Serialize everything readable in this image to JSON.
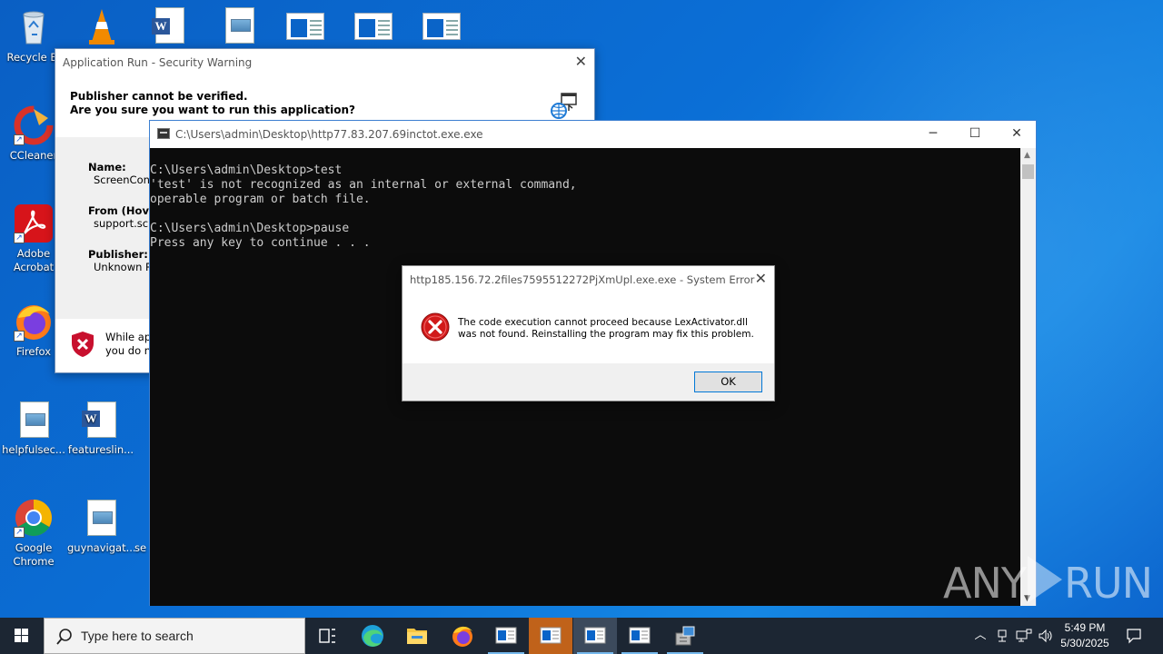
{
  "desktop_icons": [
    {
      "label": "Recycle Bi",
      "icon": "recycle-bin-icon"
    },
    {
      "label": "CCleaner",
      "icon": "ccleaner-icon"
    },
    {
      "label_line1": "Adobe",
      "label_line2": "Acrobat",
      "icon": "adobe-acrobat-icon"
    },
    {
      "label": "Firefox",
      "icon": "firefox-icon"
    },
    {
      "label": "helpfulsec...",
      "icon": "image-file-icon"
    },
    {
      "label": "featureslin...",
      "icon": "word-document-icon"
    },
    {
      "label_line1": "Google",
      "label_line2": "Chrome",
      "icon": "chrome-icon"
    },
    {
      "label": "guynavigat...",
      "icon": "image-file-icon"
    },
    {
      "label": "se",
      "icon": "file-icon"
    }
  ],
  "security_dialog": {
    "title": "Application Run - Security Warning",
    "heading_line1": "Publisher cannot be verified.",
    "heading_line2": "Are you sure you want to run this application?",
    "name_label": "Name:",
    "name_value": "ScreenConn",
    "from_label": "From (Hove",
    "from_value": "support.scre",
    "publisher_label": "Publisher:",
    "publisher_value": "Unknown P",
    "warning_line1": "While ap",
    "warning_line2": "you do n"
  },
  "console": {
    "title": "C:\\Users\\admin\\Desktop\\http77.83.207.69inctot.exe.exe",
    "lines": [
      "C:\\Users\\admin\\Desktop>test",
      "'test' is not recognized as an internal or external command,",
      "operable program or batch file.",
      "",
      "C:\\Users\\admin\\Desktop>pause",
      "Press any key to continue . . ."
    ]
  },
  "error_dialog": {
    "title": "http185.156.72.2files7595512272PjXmUpl.exe.exe - System Error",
    "message_line1": "The code execution cannot proceed because LexActivator.dll",
    "message_line2": "was not found. Reinstalling the program may fix this problem.",
    "ok_label": "OK"
  },
  "watermark": {
    "left": "ANY",
    "right": "RUN"
  },
  "taskbar": {
    "search_placeholder": "Type here to search",
    "time": "5:49 PM",
    "date": "5/30/2025"
  },
  "colors": {
    "desktop": "#0b6fd6",
    "taskbar": "#1c2633",
    "console_bg": "#0c0c0c",
    "console_text": "#cccccc",
    "error_red": "#d11a1a",
    "highlight_orange": "#c0621a"
  }
}
